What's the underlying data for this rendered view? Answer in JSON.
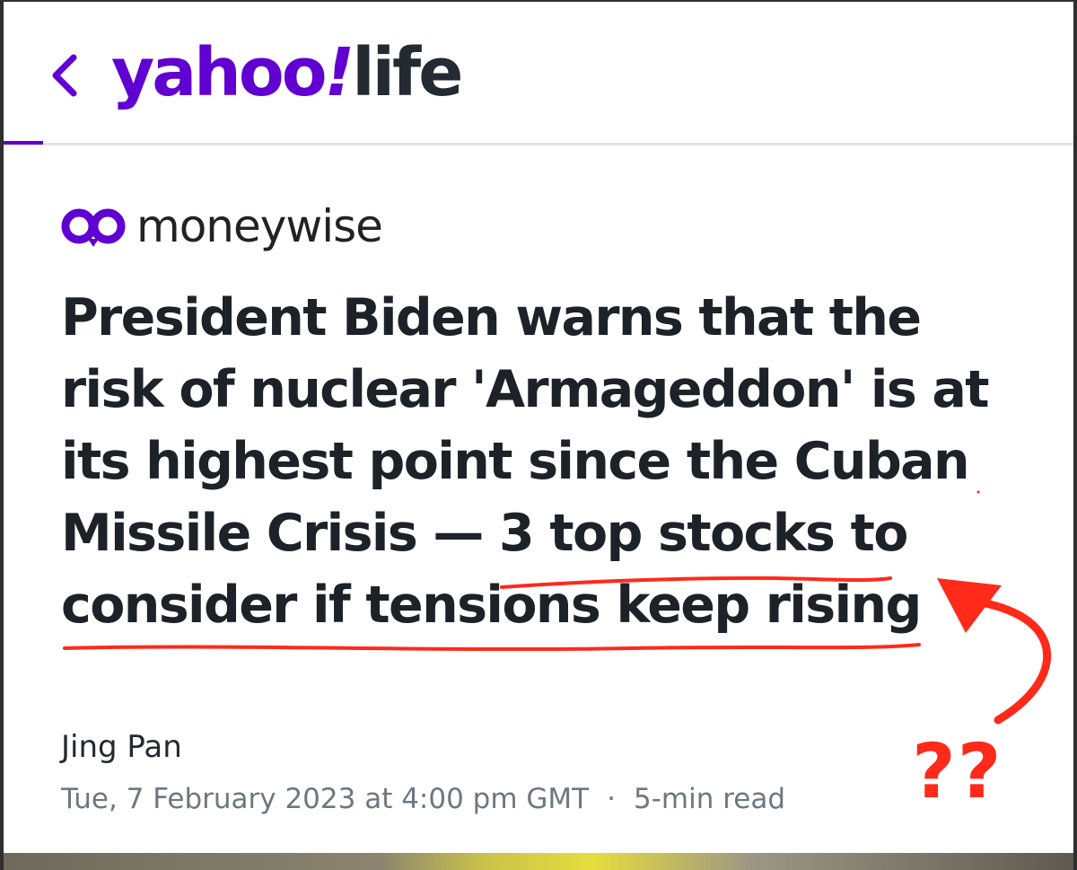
{
  "header": {
    "logo_yahoo": "yahoo",
    "logo_bang": "!",
    "logo_section": "life",
    "accent_color": "#6001d2"
  },
  "article": {
    "source": "moneywise",
    "headline_lines": [
      "President Biden warns that the",
      "risk of nuclear 'Armageddon' is at",
      "its highest point since the Cuban",
      "Missile Crisis — 3 top stocks to",
      "consider if tensions keep rising"
    ],
    "author": "Jing Pan",
    "date": "Tue, 7 February 2023 at 4:00 pm GMT",
    "separator": "·",
    "read_time": "5-min read"
  },
  "annotation": {
    "question_marks": "??",
    "color": "#ff2a1a"
  },
  "icons": {
    "back": "chevron-left-icon",
    "source_logo": "moneywise-logo-icon"
  }
}
